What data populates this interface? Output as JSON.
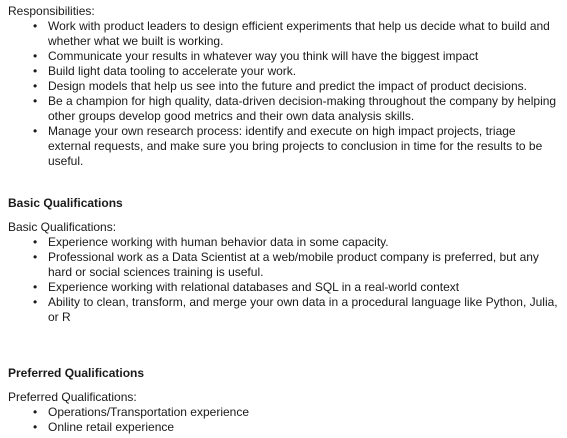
{
  "responsibilities": {
    "intro": "Responsibilities:",
    "items": [
      "Work with product leaders to design efficient experiments that help us decide what to build and whether what we built is working.",
      "Communicate your results in whatever way you think will have the biggest impact",
      "Build light data tooling to accelerate your work.",
      "Design models that help us see into the future and predict the impact of product decisions.",
      "Be a champion for high quality, data-driven decision-making throughout the company by helping other groups develop good metrics and their own data analysis skills.",
      "Manage your own research process: identify and execute on high impact projects, triage external requests, and make sure you bring projects to conclusion in time for the results to be useful."
    ]
  },
  "basic": {
    "heading": "Basic Qualifications",
    "intro": "Basic Qualifications:",
    "items": [
      "Experience working with human behavior data in some capacity.",
      "Professional work as a Data Scientist at a web/mobile product company is preferred, but any hard or social sciences training is useful.",
      "Experience working with relational databases and SQL in a real-world context",
      "Ability to clean, transform, and merge your own data in a procedural language like Python, Julia, or R"
    ]
  },
  "preferred": {
    "heading": "Preferred Qualifications",
    "intro": "Preferred Qualifications:",
    "items": [
      "Operations/Transportation experience",
      "Online retail experience"
    ]
  }
}
